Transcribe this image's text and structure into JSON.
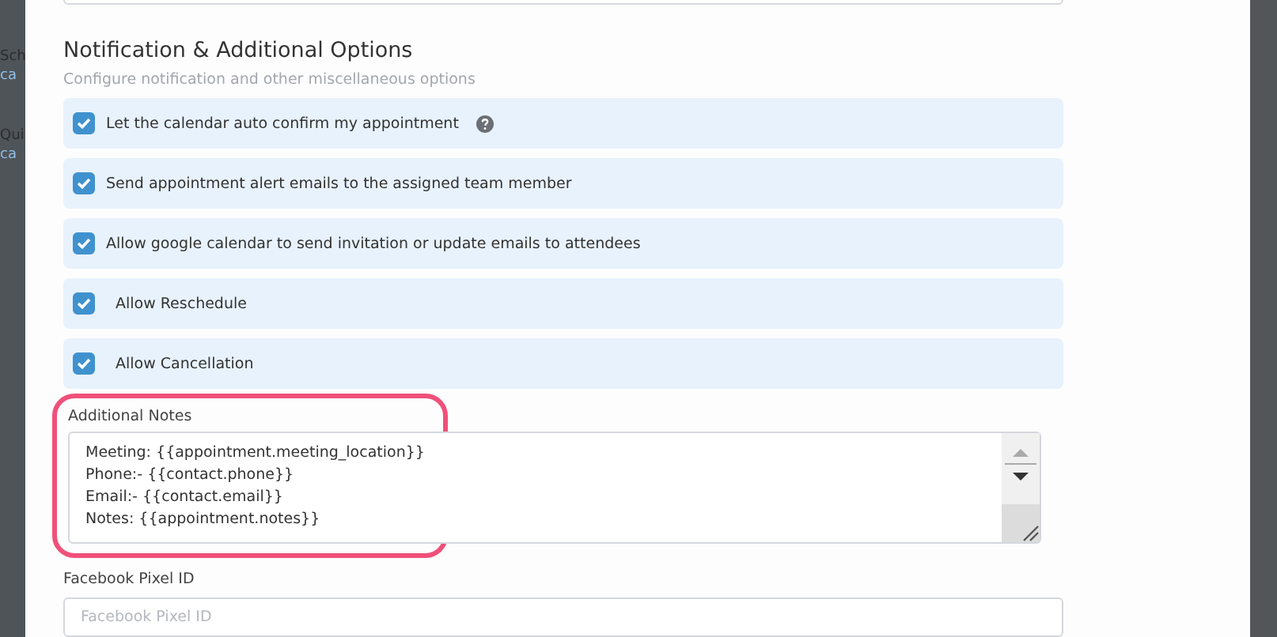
{
  "background_texts": [
    "Sch",
    "ca",
    "Qui",
    "ca"
  ],
  "section": {
    "title": "Notification & Additional Options",
    "subtitle": "Configure notification and other miscellaneous options"
  },
  "options": [
    {
      "label": "Let the calendar auto confirm my appointment",
      "checked": true,
      "help": true
    },
    {
      "label": "Send appointment alert emails to the assigned team member",
      "checked": true,
      "help": false
    },
    {
      "label": "Allow google calendar to send invitation or update emails to attendees",
      "checked": true,
      "help": false
    },
    {
      "label": "Allow Reschedule",
      "checked": true,
      "help": false
    },
    {
      "label": "Allow Cancellation",
      "checked": true,
      "help": false
    }
  ],
  "additional_notes": {
    "label": "Additional Notes",
    "highlighted": true,
    "value": "Meeting: {{appointment.meeting_location}}\nPhone:- {{contact.phone}}\nEmail:- {{contact.email}}\nNotes: {{appointment.notes}}"
  },
  "facebook_pixel": {
    "label": "Facebook Pixel ID",
    "placeholder": "Facebook Pixel ID"
  }
}
